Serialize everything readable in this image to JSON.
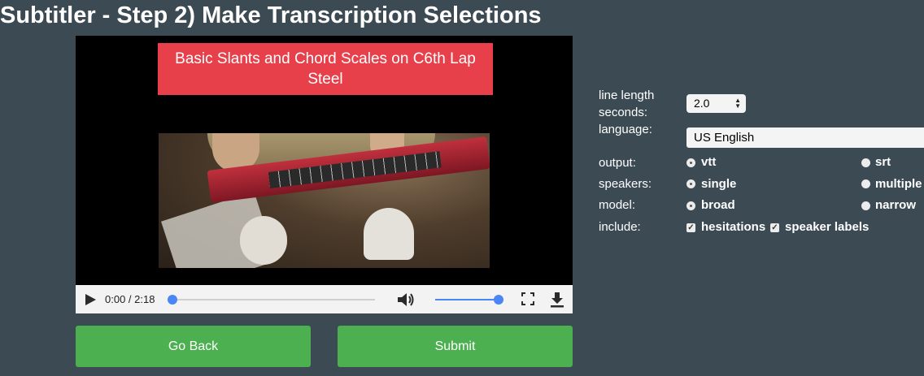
{
  "page": {
    "title": "Subtitler - Step 2) Make Transcription Selections"
  },
  "video": {
    "overlay_title": "Basic Slants and Chord Scales on C6th Lap Steel",
    "time_display": "0:00 / 2:18",
    "progress": 0.0,
    "volume": 1.0,
    "icons": [
      "play-icon",
      "volume-icon",
      "fullscreen-icon",
      "download-icon"
    ]
  },
  "buttons": {
    "back": "Go Back",
    "submit": "Submit",
    "color": "#4caf50"
  },
  "form": {
    "line_length_label_1": "line length",
    "line_length_label_2": "seconds:",
    "line_length_value": "2.0",
    "language_label": "language:",
    "language_value": "US English",
    "output": {
      "label": "output:",
      "options": [
        "vtt",
        "srt"
      ],
      "selected": "vtt"
    },
    "speakers": {
      "label": "speakers:",
      "options": [
        "single",
        "multiple"
      ],
      "selected": "single"
    },
    "model": {
      "label": "model:",
      "options": [
        "broad",
        "narrow"
      ],
      "selected": "broad"
    },
    "include": {
      "label": "include:",
      "options": [
        "hesitations",
        "speaker labels"
      ],
      "checked": [
        "hesitations",
        "speaker labels"
      ]
    }
  },
  "colors": {
    "background": "#3c4a53",
    "accent": "#4a86f5",
    "banner": "#e8404b"
  }
}
